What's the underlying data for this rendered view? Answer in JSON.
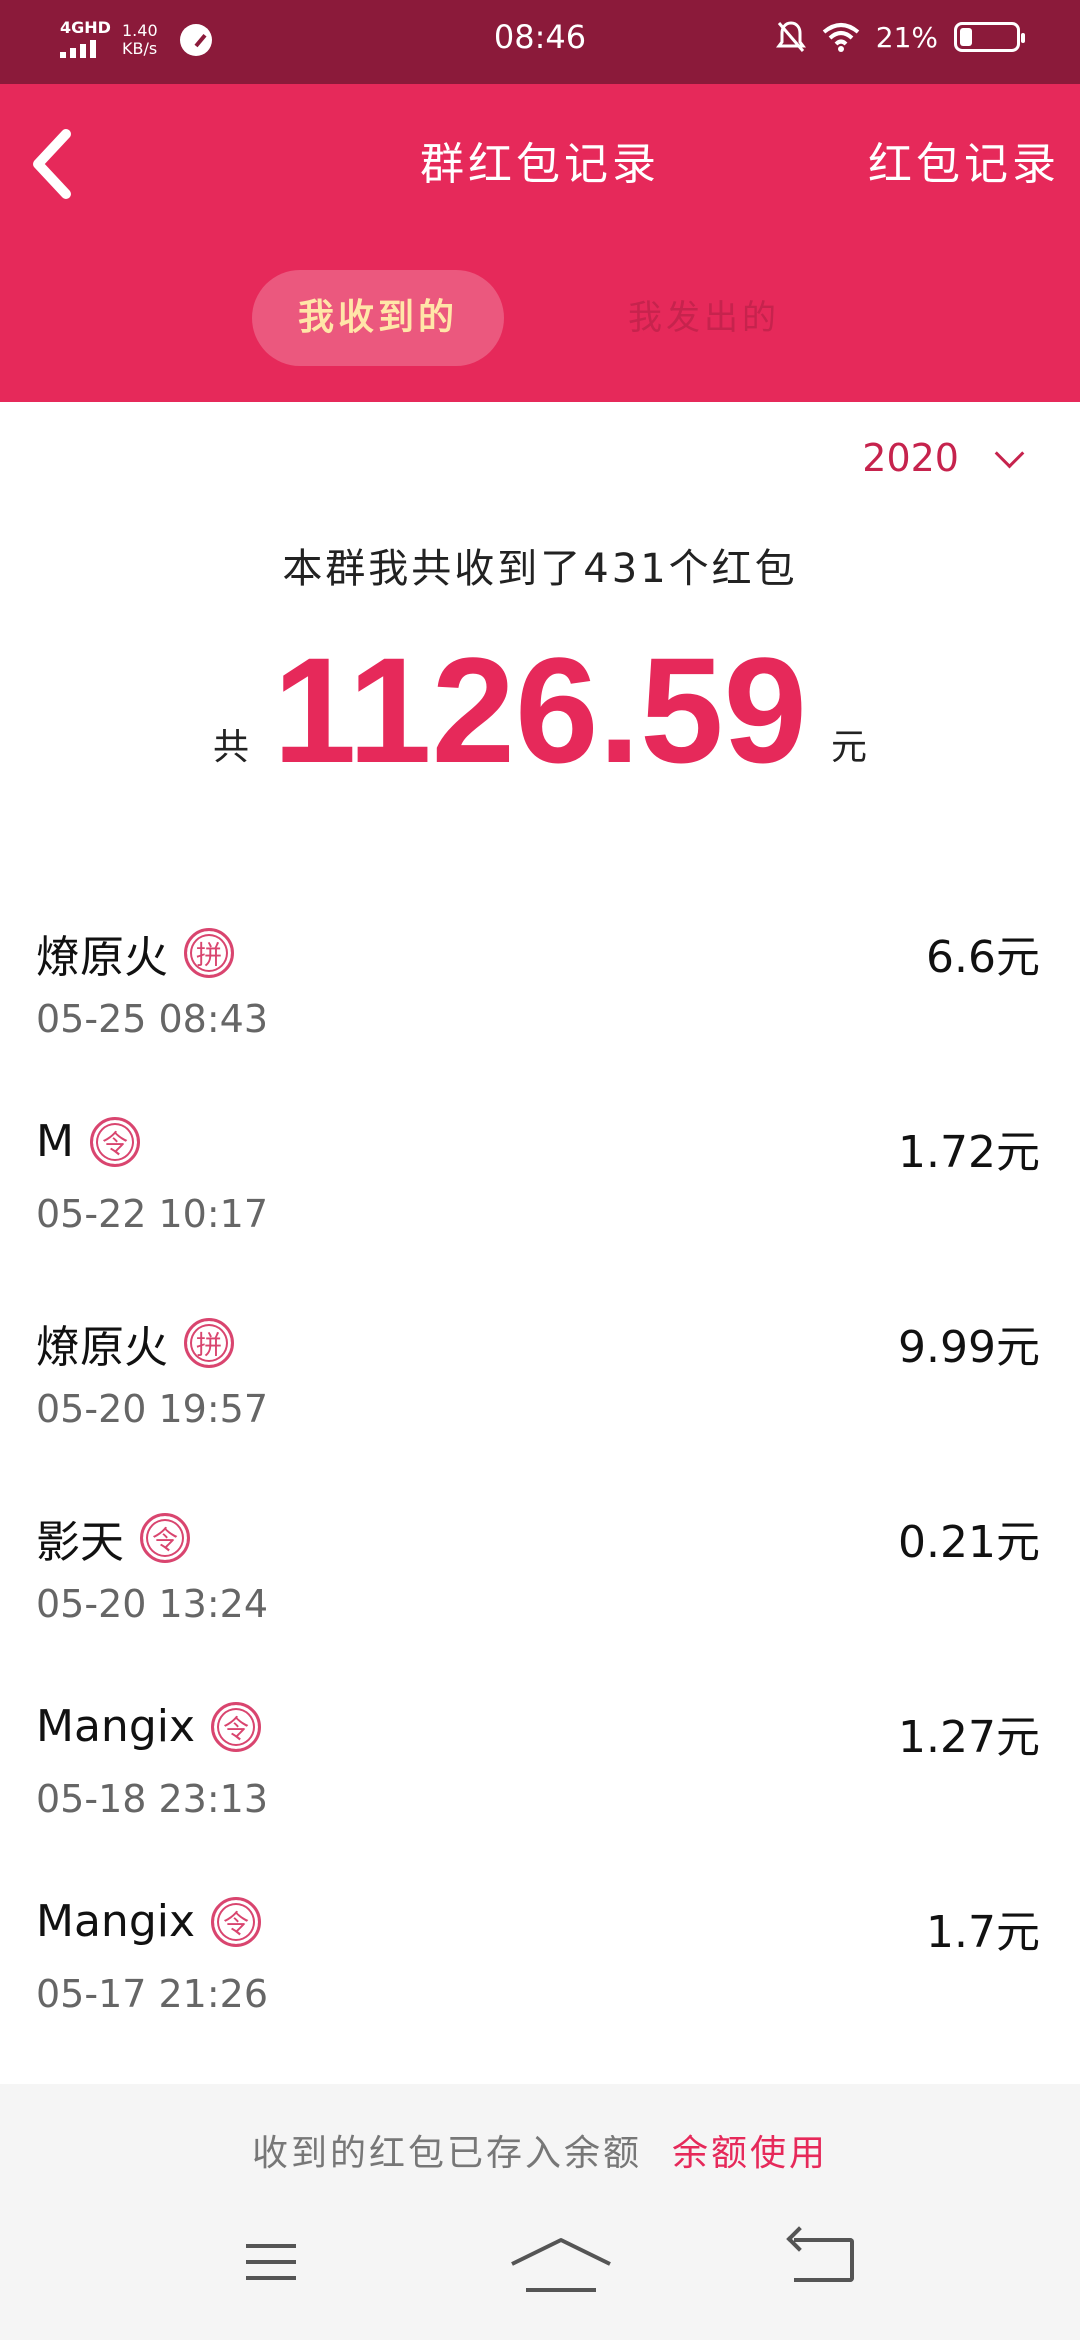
{
  "status_bar": {
    "network": "4GHD",
    "speed_value": "1.40",
    "speed_unit": "KB/s",
    "time": "08:46",
    "battery": "21%"
  },
  "header": {
    "title": "群红包记录",
    "right_link": "红包记录",
    "tabs": [
      {
        "label": "我收到的",
        "active": true
      },
      {
        "label": "我发出的",
        "active": false
      }
    ]
  },
  "filter": {
    "year": "2020"
  },
  "summary": {
    "text": "本群我共收到了431个红包",
    "total_prefix": "共",
    "total_amount": "1126.59",
    "total_suffix": "元"
  },
  "records": [
    {
      "name": "燎原火",
      "tag": "拼",
      "time": "05-25 08:43",
      "amount": "6.6元"
    },
    {
      "name": "M",
      "tag": "令",
      "time": "05-22 10:17",
      "amount": "1.72元"
    },
    {
      "name": "燎原火",
      "tag": "拼",
      "time": "05-20 19:57",
      "amount": "9.99元"
    },
    {
      "name": "影天",
      "tag": "令",
      "time": "05-20 13:24",
      "amount": "0.21元"
    },
    {
      "name": "Mangix",
      "tag": "令",
      "time": "05-18 23:13",
      "amount": "1.27元"
    },
    {
      "name": "Mangix",
      "tag": "令",
      "time": "05-17 21:26",
      "amount": "1.7元"
    }
  ],
  "footer": {
    "notice": "收到的红包已存入余额",
    "link": "余额使用"
  },
  "colors": {
    "status_bar": "#8b1a3a",
    "brand": "#e6295a",
    "active_tab_text": "#ffe6a8"
  },
  "icons": [
    "back-arrow-icon",
    "speedometer-icon",
    "mute-icon",
    "wifi-icon",
    "battery-icon",
    "chevron-down-icon",
    "menu-icon",
    "home-icon",
    "return-icon"
  ]
}
